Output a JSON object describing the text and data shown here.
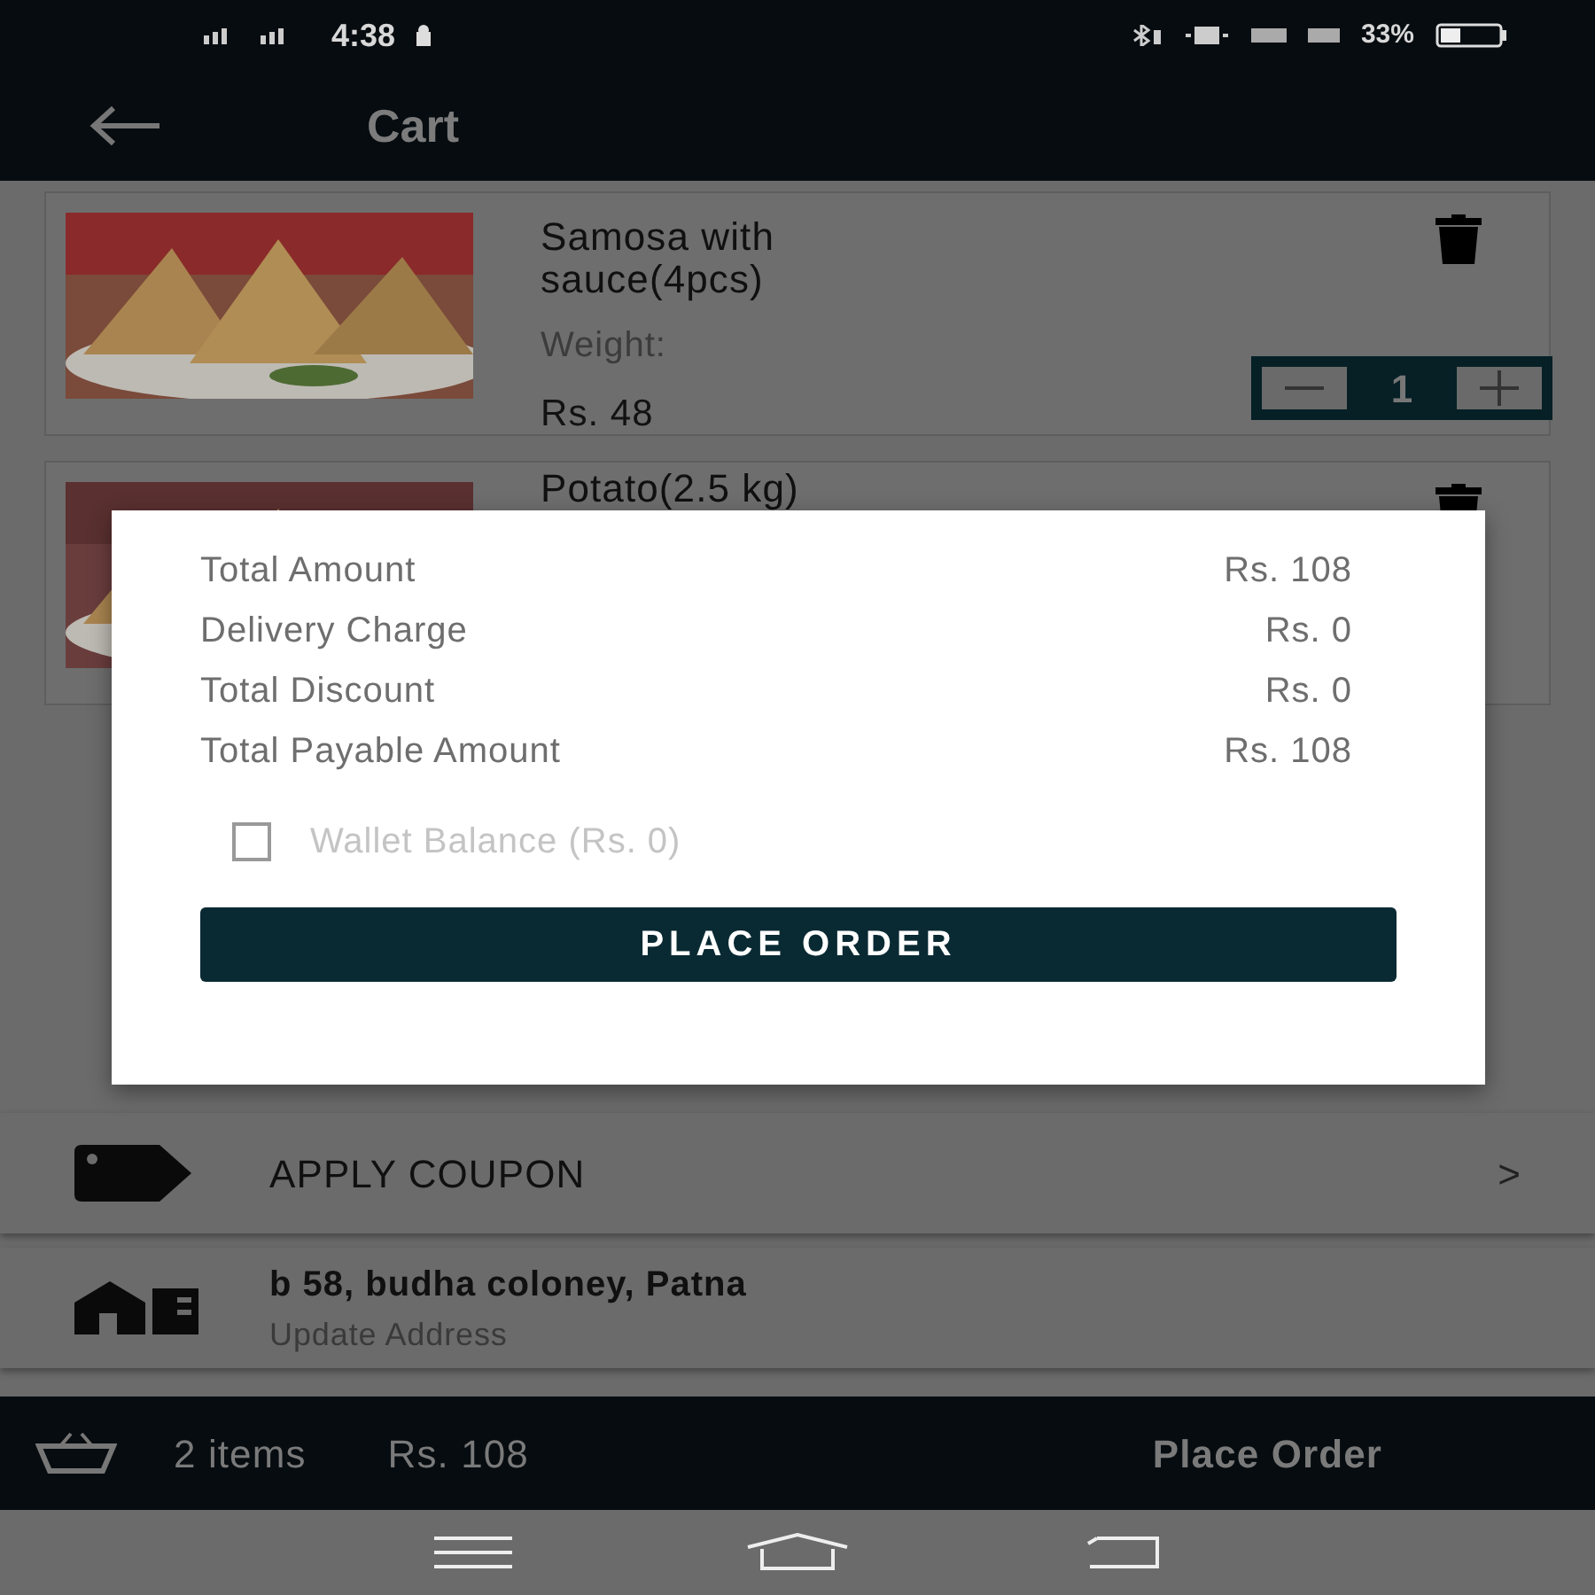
{
  "status_bar": {
    "time": "4:38",
    "battery": "33%"
  },
  "header": {
    "title": "Cart"
  },
  "cart_items": [
    {
      "name": "Samosa with sauce(4pcs)",
      "weight_label": "Weight:",
      "price": "Rs. 48",
      "quantity": "1"
    },
    {
      "name": "Potato(2.5 kg)"
    }
  ],
  "summary": {
    "rows": [
      {
        "label": "Total Amount",
        "value": "Rs. 108"
      },
      {
        "label": "Delivery Charge",
        "value": "Rs. 0"
      },
      {
        "label": "Total Discount",
        "value": "Rs. 0"
      },
      {
        "label": "Total Payable Amount",
        "value": "Rs. 108"
      }
    ],
    "wallet": {
      "label": "Wallet Balance (Rs. 0)",
      "checked": false
    },
    "button": "PLACE ORDER"
  },
  "coupon": {
    "label": "APPLY COUPON",
    "chevron": ">"
  },
  "address": {
    "line": "b 58, budha coloney, Patna",
    "action": "Update Address"
  },
  "bottom_bar": {
    "count": "2 items",
    "total": "Rs. 108",
    "action": "Place Order"
  }
}
